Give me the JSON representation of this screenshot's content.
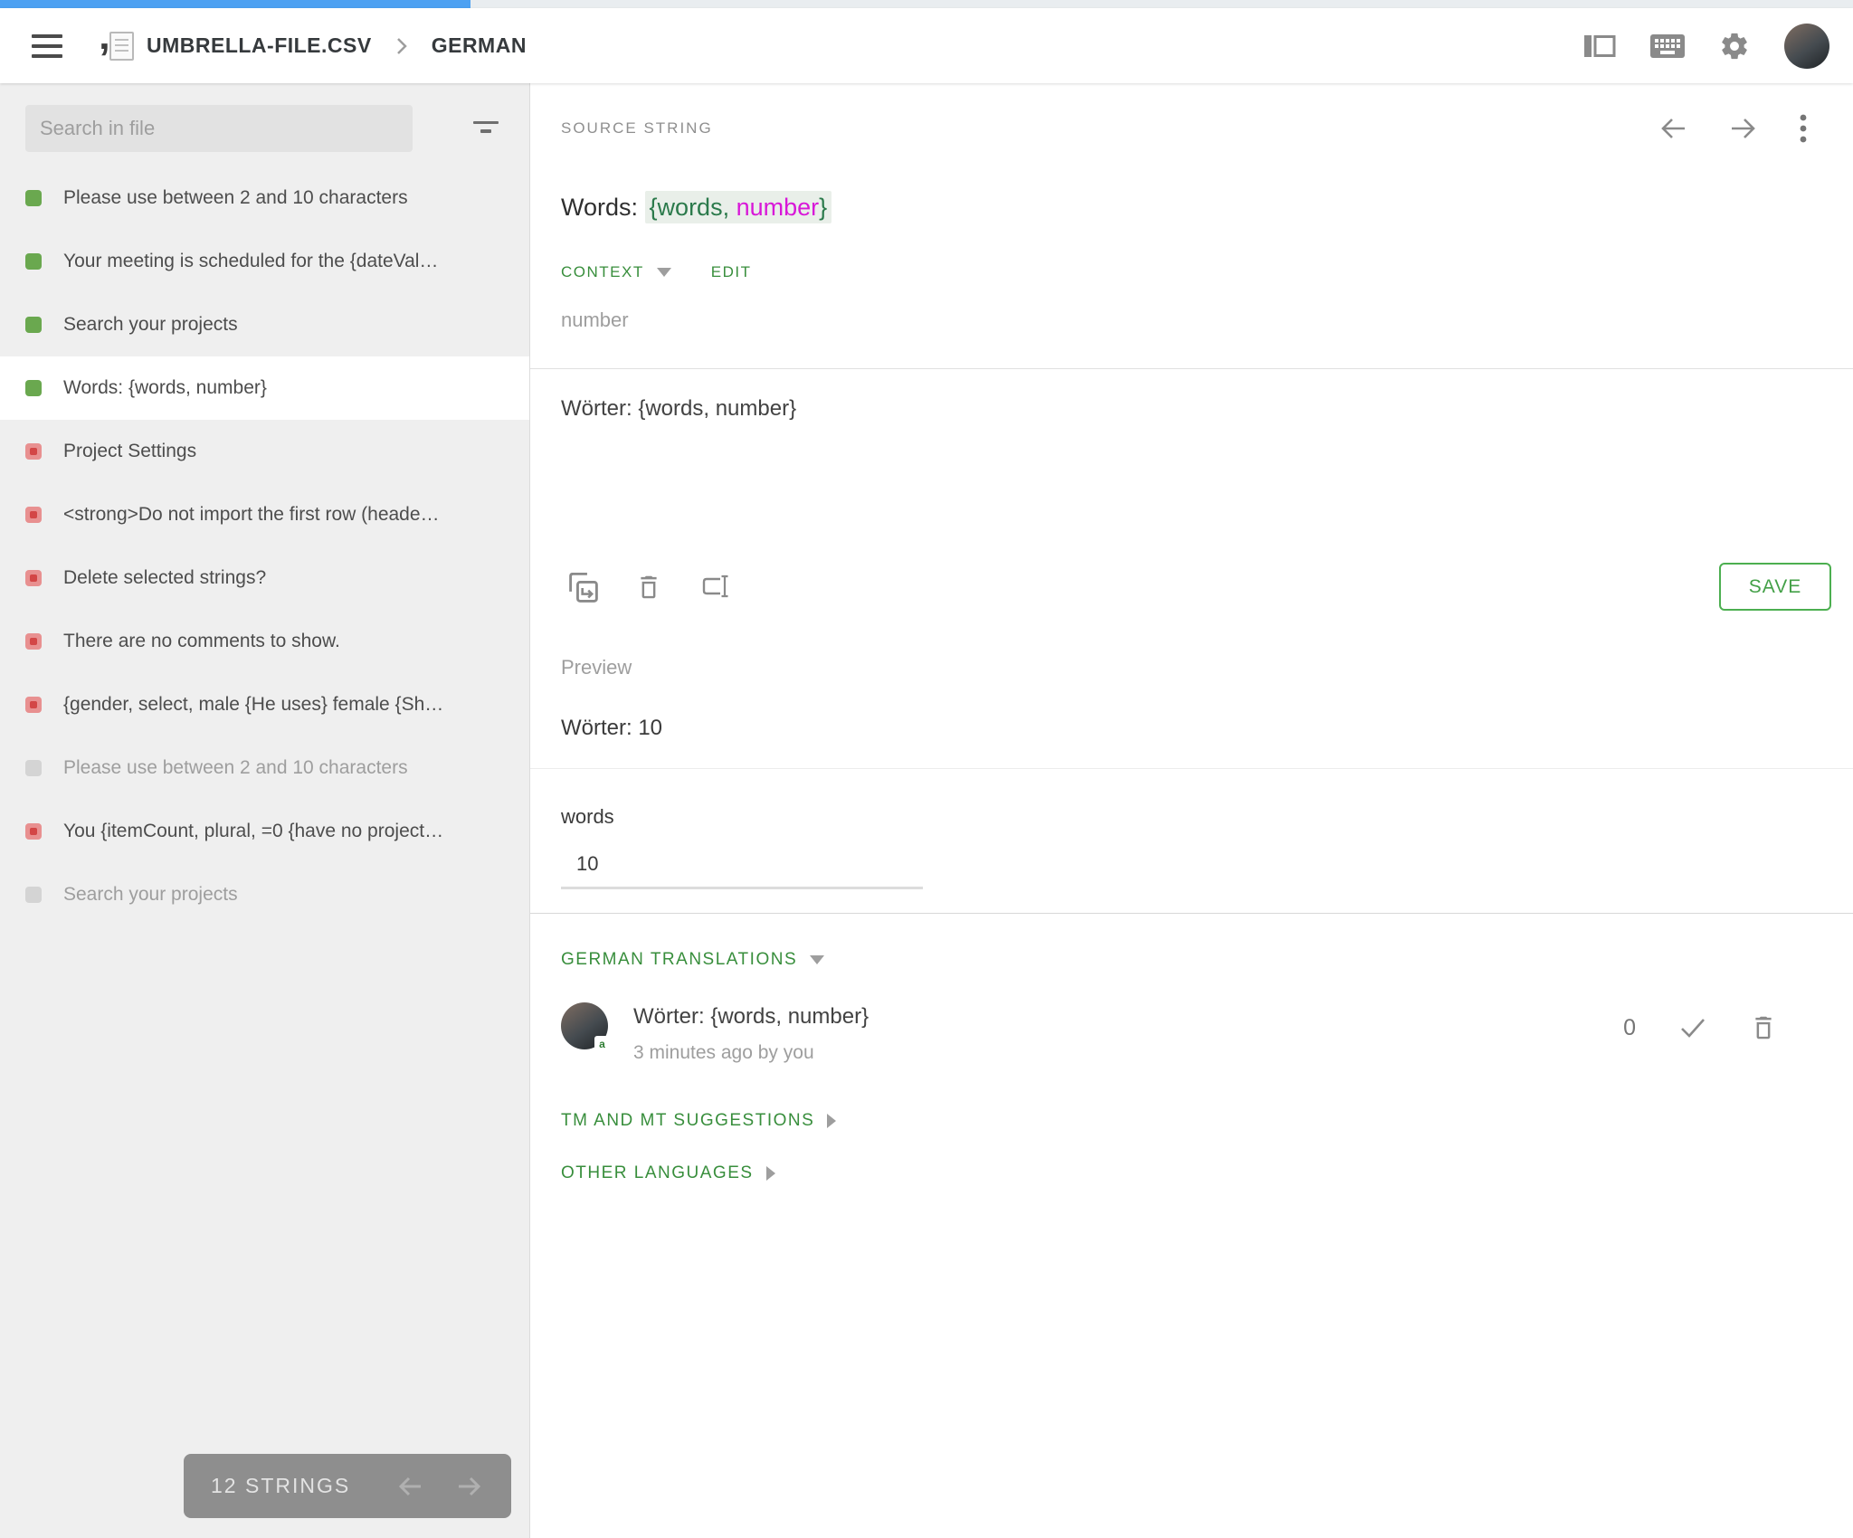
{
  "header": {
    "file_name": "UMBRELLA-FILE.CSV",
    "language": "GERMAN"
  },
  "sidebar": {
    "search_placeholder": "Search in file",
    "strings": [
      {
        "text": "Please use between 2 and 10 characters",
        "status": "translated",
        "selected": false
      },
      {
        "text": "Your meeting is scheduled for the {dateVal…",
        "status": "translated",
        "selected": false
      },
      {
        "text": "Search your projects",
        "status": "translated",
        "selected": false
      },
      {
        "text": "Words: {words, number}",
        "status": "translated",
        "selected": true
      },
      {
        "text": "Project Settings",
        "status": "untranslated",
        "selected": false
      },
      {
        "text": "<strong>Do not import the first row (heade…",
        "status": "untranslated",
        "selected": false
      },
      {
        "text": "Delete selected strings?",
        "status": "untranslated",
        "selected": false
      },
      {
        "text": "There are no comments to show.",
        "status": "untranslated",
        "selected": false
      },
      {
        "text": "{gender, select, male {He uses} female {Sh…",
        "status": "untranslated",
        "selected": false
      },
      {
        "text": "Please use between 2 and 10 characters",
        "status": "inactive",
        "selected": false
      },
      {
        "text": "You {itemCount, plural, =0 {have no project…",
        "status": "untranslated",
        "selected": false
      },
      {
        "text": "Search your projects",
        "status": "inactive",
        "selected": false
      }
    ],
    "pager": {
      "count_label": "12 STRINGS"
    }
  },
  "source_panel": {
    "label": "SOURCE STRING",
    "text_prefix": "Words: ",
    "placeholder_open": "{words, ",
    "placeholder_param": "number",
    "placeholder_close": "}",
    "context_label": "CONTEXT",
    "edit_label": "EDIT",
    "context_value": "number"
  },
  "editor": {
    "translation_text": "Wörter: {words, number}",
    "save_label": "SAVE"
  },
  "preview": {
    "label": "Preview",
    "rendered_text": "Wörter: 10",
    "param_label": "words",
    "param_value": "10"
  },
  "translations": {
    "label": "GERMAN TRANSLATIONS",
    "items": [
      {
        "text": "Wörter: {words, number}",
        "meta": "3 minutes ago by you",
        "votes": "0"
      }
    ],
    "badge_glyph": "a",
    "tm_label": "TM AND MT SUGGESTIONS",
    "other_label": "OTHER LANGUAGES"
  },
  "colors": {
    "accent_green": "#388e3c",
    "save_green": "#43a047",
    "placeholder_green": "#2b7a4b",
    "placeholder_magenta": "#d818d8",
    "placeholder_highlight_bg": "#e9efe9",
    "status_translated": "#6aa84f",
    "status_untranslated": "#d34646",
    "status_inactive": "#d4d4d4",
    "progress_blue": "#4da1f2",
    "sidebar_bg": "#efefef"
  }
}
